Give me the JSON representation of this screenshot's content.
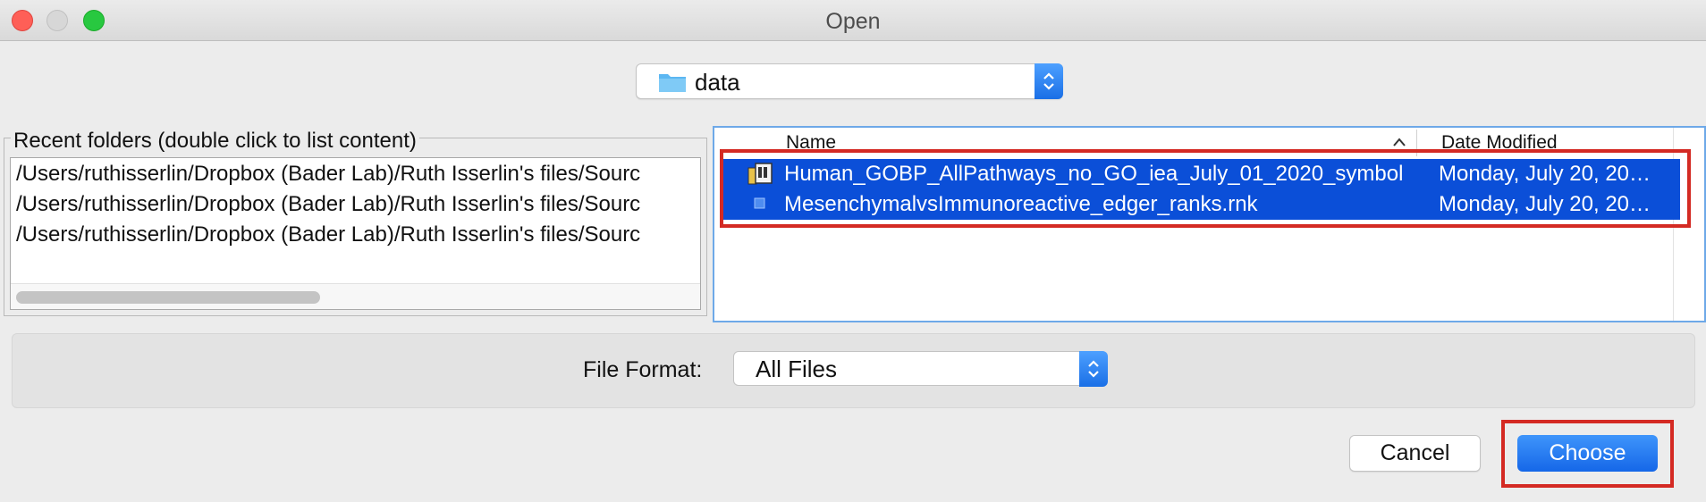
{
  "window": {
    "title": "Open"
  },
  "folder_select": {
    "value": "data",
    "icon": "folder-icon"
  },
  "recent_folders": {
    "legend": "Recent folders (double click to list content)",
    "items": [
      "/Users/ruthisserlin/Dropbox (Bader Lab)/Ruth Isserlin's files/Sourc",
      "/Users/ruthisserlin/Dropbox (Bader Lab)/Ruth Isserlin's files/Sourc",
      "/Users/ruthisserlin/Dropbox (Bader Lab)/Ruth Isserlin's files/Sourc"
    ]
  },
  "file_table": {
    "columns": {
      "name": "Name",
      "date": "Date Modified"
    },
    "rows": [
      {
        "name": "Human_GOBP_AllPathways_no_GO_iea_July_01_2020_symbol",
        "date": "Monday, July 20, 20…",
        "icon": "gmt-file-icon",
        "selected": true
      },
      {
        "name": "MesenchymalvsImmunoreactive_edger_ranks.rnk",
        "date": "Monday, July 20, 20…",
        "icon": "rnk-file-icon",
        "selected": true
      }
    ]
  },
  "file_format": {
    "label": "File Format:",
    "value": "All Files"
  },
  "buttons": {
    "cancel": "Cancel",
    "choose": "Choose"
  },
  "colors": {
    "selection": "#0b4fd8",
    "accent": "#1a6fe6",
    "annotation": "#d42a23"
  }
}
